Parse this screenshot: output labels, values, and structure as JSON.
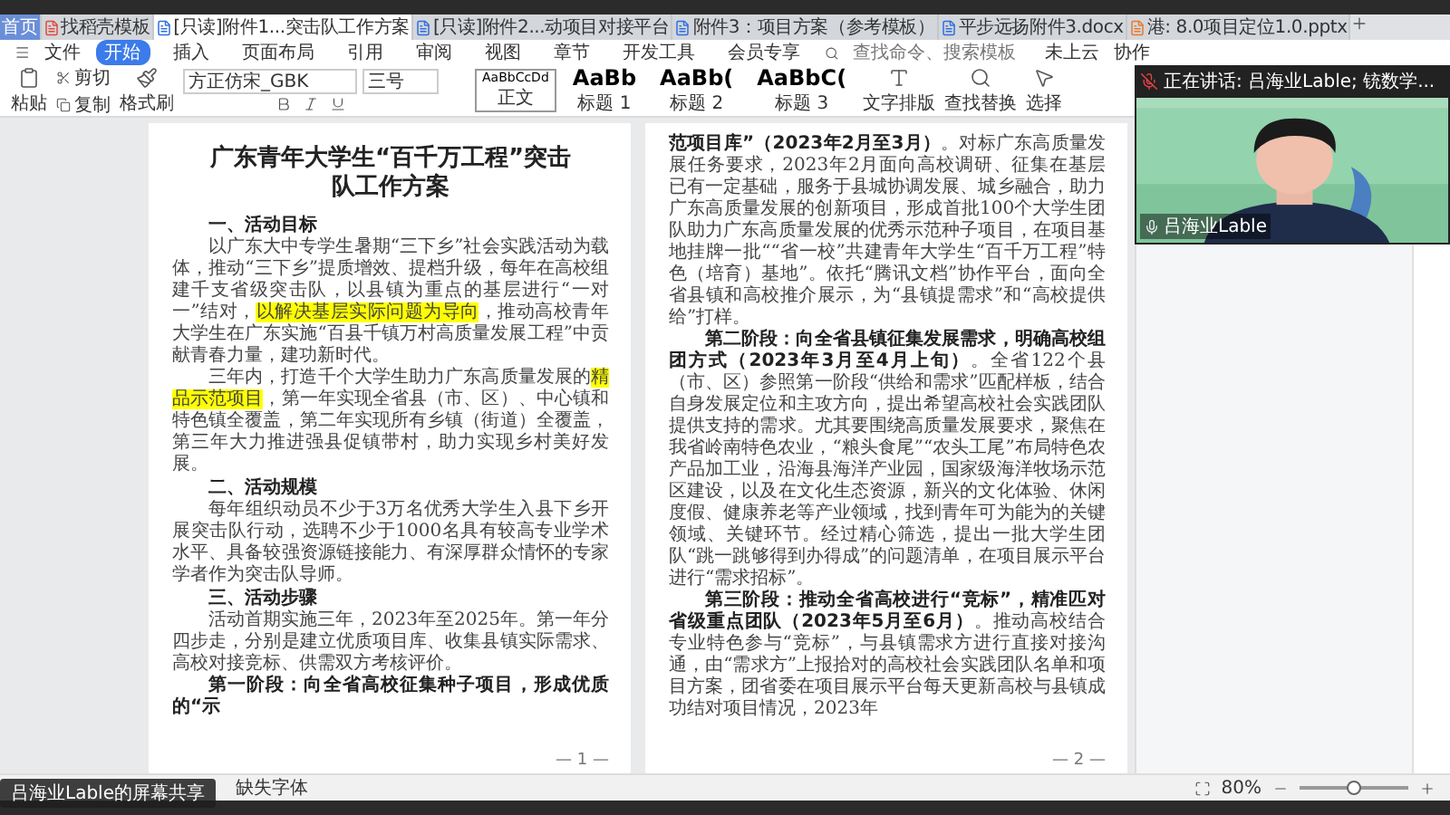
{
  "tabs": [
    {
      "kind": "home",
      "label": "首页",
      "selected": false
    },
    {
      "kind": "template",
      "label": "找稻壳模板",
      "selected": false
    },
    {
      "kind": "doc",
      "label": "[只读]附件1...突击队工作方案",
      "selected": true
    },
    {
      "kind": "doc",
      "label": "[只读]附件2...动项目对接平台",
      "selected": false
    },
    {
      "kind": "doc",
      "label": "附件3：项目方案（参考模板）",
      "selected": false
    },
    {
      "kind": "doc",
      "label": "平步远扬附件3.docx",
      "selected": false
    },
    {
      "kind": "ppt",
      "label": "港: 8.0项目定位1.0.pptx",
      "selected": false
    }
  ],
  "menu": {
    "file": "文件",
    "items": [
      {
        "label": "开始",
        "selected": true
      },
      {
        "label": "插入",
        "selected": false
      },
      {
        "label": "页面布局",
        "selected": false
      },
      {
        "label": "引用",
        "selected": false
      },
      {
        "label": "审阅",
        "selected": false
      },
      {
        "label": "视图",
        "selected": false
      },
      {
        "label": "章节",
        "selected": false
      },
      {
        "label": "开发工具",
        "selected": false
      },
      {
        "label": "会员专享",
        "selected": false
      }
    ],
    "search": {
      "placeholder": "查找命令、搜索模板"
    },
    "cloud": [
      "未上云",
      "协作"
    ]
  },
  "ribbon": {
    "paste": "粘贴",
    "cut": "剪切",
    "copy": "复制",
    "format_painter": "格式刷",
    "font_name": "方正仿宋_GBK",
    "font_size": "三号",
    "styles": [
      {
        "sample": "AaBbCcDd",
        "label": "正文",
        "selected": true
      },
      {
        "sample": "AaBb",
        "label": "标题 1",
        "selected": false
      },
      {
        "sample": "AaBb(",
        "label": "标题 2",
        "selected": false
      },
      {
        "sample": "AaBbC(",
        "label": "标题 3",
        "selected": false
      }
    ],
    "tools": [
      {
        "kind": "layout",
        "label": "文字排版"
      },
      {
        "kind": "find",
        "label": "查找替换"
      },
      {
        "kind": "select",
        "label": "选择"
      }
    ]
  },
  "pages": [
    {
      "page_number": "— 1 —",
      "blocks": [
        {
          "kind": "title",
          "segments": [
            {
              "text": "广东青年大学生“百千万工程”突击队工作方案",
              "highlighted": false
            }
          ]
        },
        {
          "kind": "heading",
          "segments": [
            {
              "text": "一、活动目标",
              "highlighted": false
            }
          ]
        },
        {
          "kind": "para",
          "segments": [
            {
              "text": "以广东大中专学生暑期“三下乡”社会实践活动为载体，推动“三下乡”提质增效、提档升级，每年在高校组建千支省级突击队，以县镇为重点的基层进行“一对一”结对，",
              "highlighted": false
            },
            {
              "text": "以解决基层实际问题为导向",
              "highlighted": true
            },
            {
              "text": "，推动高校青年大学生在广东实施“百县千镇万村高质量发展工程”中贡献青春力量，建功新时代。",
              "highlighted": false
            }
          ]
        },
        {
          "kind": "para",
          "segments": [
            {
              "text": "三年内，打造千个大学生助力广东高质量发展的",
              "highlighted": false
            },
            {
              "text": "精品示范项目",
              "highlighted": true
            },
            {
              "text": "，第一年实现全省县（市、区）、中心镇和特色镇全覆盖，第二年实现所有乡镇（街道）全覆盖，第三年大力推进强县促镇带村，助力实现乡村美好发展。",
              "highlighted": false
            }
          ]
        },
        {
          "kind": "heading",
          "segments": [
            {
              "text": "二、活动规模",
              "highlighted": false
            }
          ]
        },
        {
          "kind": "para",
          "segments": [
            {
              "text": "每年组织动员不少于3万名优秀大学生入县下乡开展突击队行动，选聘不少于1000名具有较高专业学术水平、具备较强资源链接能力、有深厚群众情怀的专家学者作为突击队导师。",
              "highlighted": false
            }
          ]
        },
        {
          "kind": "heading",
          "segments": [
            {
              "text": "三、活动步骤",
              "highlighted": false
            }
          ]
        },
        {
          "kind": "para",
          "segments": [
            {
              "text": "活动首期实施三年，2023年至2025年。第一年分四步走，分别是建立优质项目库、收集县镇实际需求、高校对接竞标、供需双方考核评价。",
              "highlighted": false
            }
          ]
        },
        {
          "kind": "para",
          "segments": [
            {
              "text": "**第一阶段：向全省高校征集种子项目，形成优质的“示**",
              "highlighted": false
            }
          ]
        }
      ]
    },
    {
      "page_number": "— 2 —",
      "blocks": [
        {
          "kind": "continued",
          "segments": [
            {
              "text": "**范项目库”（2023年2月至3月）**。对标广东高质量发展任务要求，2023年2月面向高校调研、征集在基层已有一定基础，服务于县城协调发展、城乡融合，助力广东高质量发展的创新项目，形成首批100个大学生团队助力广东高质量发展的优秀示范种子项目，在项目基地挂牌一批““省一校”共建青年大学生“百千万工程”特色（培育）基地”。依托“腾讯文档”协作平台，面向全省县镇和高校推介展示，为“县镇提需求”和“高校提供给”打样。",
              "highlighted": false
            }
          ]
        },
        {
          "kind": "para",
          "segments": [
            {
              "text": "**第二阶段：向全省县镇征集发展需求，明确高校组团方式（2023年3月至4月上旬）**。全省122个县（市、区）参照第一阶段“供给和需求”匹配样板，结合自身发展定位和主攻方向，提出希望高校社会实践团队提供支持的需求。尤其要围绕高质量发展要求，聚焦在我省岭南特色农业，“粮头食尾”“农头工尾”布局特色农产品加工业，沿海县海洋产业园，国家级海洋牧场示范区建设，以及在文化生态资源，新兴的文化体验、休闲度假、健康养老等产业领域，找到青年可为能为的关键领域、关键环节。经过精心筛选，提出一批大学生团队“跳一跳够得到办得成”的问题清单，在项目展示平台进行“需求招标”。",
              "highlighted": false
            }
          ]
        },
        {
          "kind": "para",
          "segments": [
            {
              "text": "**第三阶段：推动全省高校进行“竞标”，精准匹对省级重点团队（2023年5月至6月）**。推动高校结合专业特色参与“竞标”，与县镇需求方进行直接对接沟通，由“需求方”上报拾对的高校社会实践团队名单和项目方案，团省委在项目展示平台每天更新高校与县镇成功结对项目情况，2023年",
              "highlighted": false
            }
          ]
        }
      ]
    }
  ],
  "status_bar": {
    "missing_fonts": "缺失字体",
    "zoom": "80%",
    "zoom_slider": {
      "level": 0.5
    }
  },
  "video": {
    "speaking": "正在讲话: 吕海业Lable; 铳数学...",
    "name": "吕海业Lable"
  },
  "share_label": "吕海业Lable的屏幕共享"
}
